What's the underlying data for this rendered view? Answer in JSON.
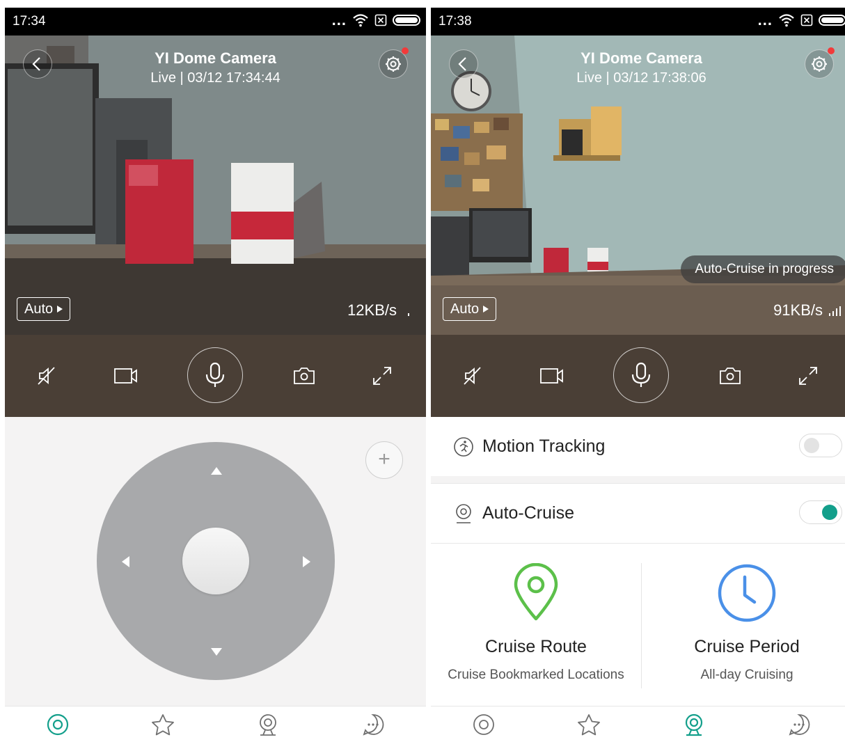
{
  "screens": [
    {
      "status_time": "17:34",
      "camera_title": "YI Dome Camera",
      "camera_subtitle": "Live | 03/12 17:34:44",
      "quality_label": "Auto",
      "speed": "12KB/s",
      "active_tab": "live-view"
    },
    {
      "status_time": "17:38",
      "camera_title": "YI Dome Camera",
      "camera_subtitle": "Live | 03/12 17:38:06",
      "quality_label": "Auto",
      "speed": "91KB/s",
      "toast": "Auto-Cruise in progress",
      "motion_tracking": {
        "label": "Motion Tracking",
        "enabled": false
      },
      "auto_cruise": {
        "label": "Auto-Cruise",
        "enabled": true
      },
      "cards": [
        {
          "title": "Cruise Route",
          "subtitle": "Cruise Bookmarked Locations",
          "icon": "location-pin-icon",
          "color": "#5cc04a"
        },
        {
          "title": "Cruise Period",
          "subtitle": "All-day Cruising",
          "icon": "clock-icon",
          "color": "#4a90e8"
        }
      ],
      "active_tab": "cruise"
    }
  ],
  "colors": {
    "accent": "#139f8b",
    "control_bar": "#4a3f36",
    "notification_dot": "#f23a3a"
  }
}
